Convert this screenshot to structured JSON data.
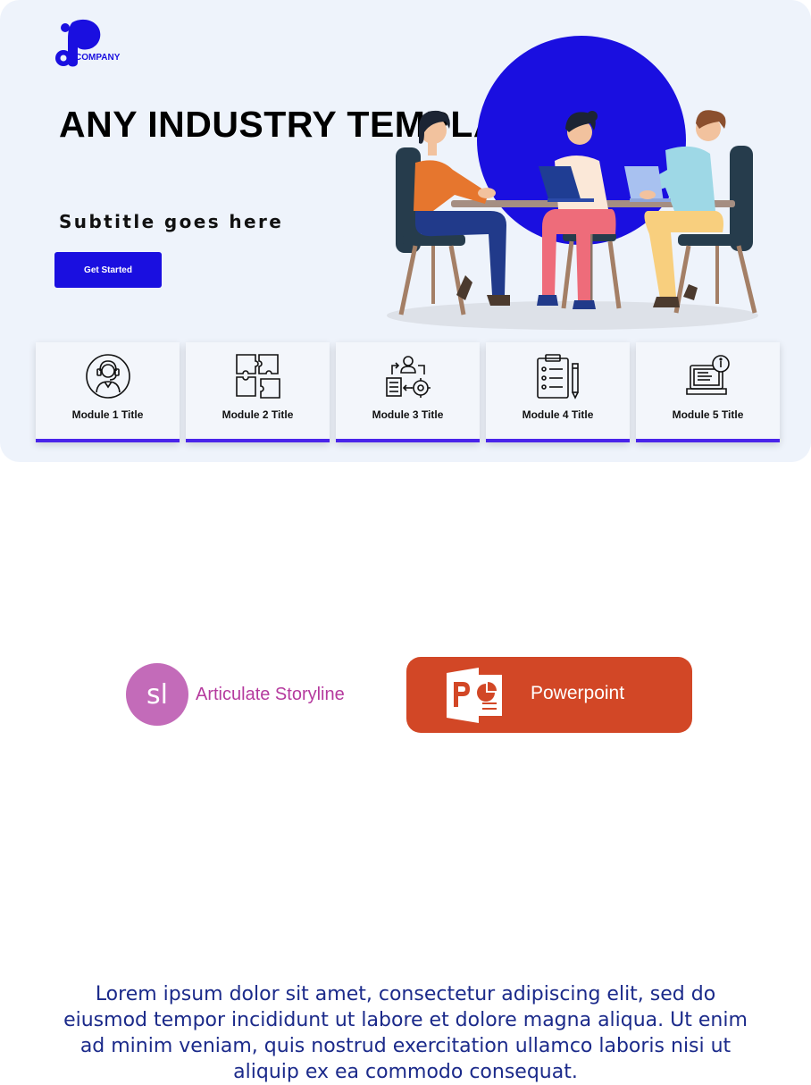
{
  "brand": {
    "logo_text": "COMPANY",
    "accent": "#1a0fe0"
  },
  "hero": {
    "title": "ANY INDUSTRY TEMPLATE",
    "subtitle": "Subtitle goes here",
    "cta_label": "Get Started",
    "background": "#eef3fb"
  },
  "modules": [
    {
      "title": "Module 1 Title",
      "icon": "customer-support-icon"
    },
    {
      "title": "Module 2 Title",
      "icon": "puzzle-icon"
    },
    {
      "title": "Module 3 Title",
      "icon": "workflow-gear-icon"
    },
    {
      "title": "Module 4 Title",
      "icon": "checklist-clipboard-icon"
    },
    {
      "title": "Module 5 Title",
      "icon": "laptop-info-icon"
    }
  ],
  "tools": {
    "storyline": {
      "badge": "sl",
      "label": "Articulate Storyline",
      "color": "#c36bb9"
    },
    "powerpoint": {
      "label": "Powerpoint",
      "color": "#d24726"
    }
  },
  "body_text": "Lorem ipsum dolor sit amet, consectetur adipiscing elit, sed do eiusmod tempor incididunt ut labore et dolore magna aliqua. Ut enim ad minim veniam, quis nostrud exercitation ullamco laboris nisi ut aliquip ex ea commodo consequat."
}
